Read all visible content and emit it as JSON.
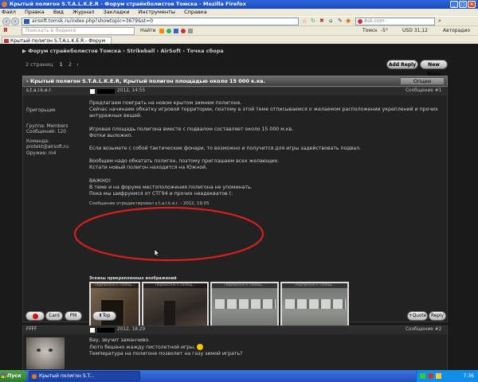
{
  "window": {
    "title": "Крытый полигон S.T.A.L.K.E.R - Форум страйкболистов Томска - Mozilla Firefox",
    "controls": [
      "_",
      "□",
      "×"
    ]
  },
  "menu": [
    "Файл",
    "Правка",
    "Вид",
    "Журнал",
    "Закладки",
    "Инструменты",
    "Справка"
  ],
  "nav": {
    "url": "airsoft.tomsk.ru/index.php?showtopic=3679&st=0",
    "search_placeholder": "Ask.com",
    "search_label": "Ask.com"
  },
  "yandex": {
    "search_placeholder": "Поискать в Яндексе",
    "find_label": "Найти",
    "tomsk_label": "Томск",
    "weather": "-5°",
    "currency": "USD 31,12",
    "car_label": "Авторадио",
    "mail_label": "Почта"
  },
  "tab": {
    "label": "Крытый полигон S.T.A.L.K.E.R - Форум ст..."
  },
  "breadcrumb": "▶ Форум страйкболистов Томска › Strikeball › AirSoft › Точка сбора",
  "pages": {
    "label": "2 страниц",
    "current": "1",
    "next": "2"
  },
  "buttons": {
    "add_reply": "Add Reply",
    "new_topic": "New Topic"
  },
  "thread": {
    "title": "› Крытый полигон S.T.A.L.K.E.R, Крытый полигон площадью около 15 000 к.кв.",
    "options": "Опции"
  },
  "post1": {
    "author": "s.t.a.l.k.e.r.",
    "date": "2012, 14:55",
    "number": "Сообщение #1",
    "group_label": "Пригорьцик",
    "meta": [
      "Группа: Members",
      "Сообщений: 120",
      "Команда: protekt@airsoft.ru",
      "Оружие: m4"
    ],
    "paragraphs": [
      "Предлагаем поиграть на новом крытом зимнем полигоне.",
      "Сейчас начинаем обкатку игровой территории, поэтому в этой теме отписываемся о желаемом расположении укреплений и прочих антуражных вещей.",
      "Игровая площадь полигона вместе с подвалом составляет около 15 000 м.кв.",
      "Фотки выложил.",
      "Если возьмете с собой тактические фонари, то возможно и получится для игры задействовать подвал.",
      "Вообщем надо обкатать полигон, поэтому приглашаем всех желающих.",
      "Кстати новый полигон находится на Южной."
    ],
    "important": [
      "ВАЖНО!",
      "В теме и на форуме местоположения полигона не упоминать.",
      "Пока мы шифруемся от СТГ94 и прочих неадекватов (:"
    ],
    "edited": "Сообщение отредактировал s.t.a.l.k.e.r. - 2012, 19:05",
    "attached_label": "Эскизы прикрепленных изображений",
    "thumb_caption": "Подписано к сообщ...",
    "actions": {
      "card": "Card",
      "pm": "PM",
      "top": "Top",
      "quote": "+Quote",
      "reply": "Reply"
    }
  },
  "post2": {
    "author": "FFFF",
    "date": "2012, 18:29",
    "number": "Сообщение #2",
    "lines": [
      "Вау, звучит заманчиво.",
      "Люто бешено жажду пистолетной игры.",
      "Температура на полигоне позволит на газу зимой играть?"
    ]
  },
  "taskbar": {
    "start": "Пуск",
    "item": "Крытый полигон S.T...",
    "clock": "7:36"
  },
  "colors": {
    "accent": "#2d64d8",
    "ellipse": "#d81f1f",
    "page_bg": "#1a1a1a"
  }
}
